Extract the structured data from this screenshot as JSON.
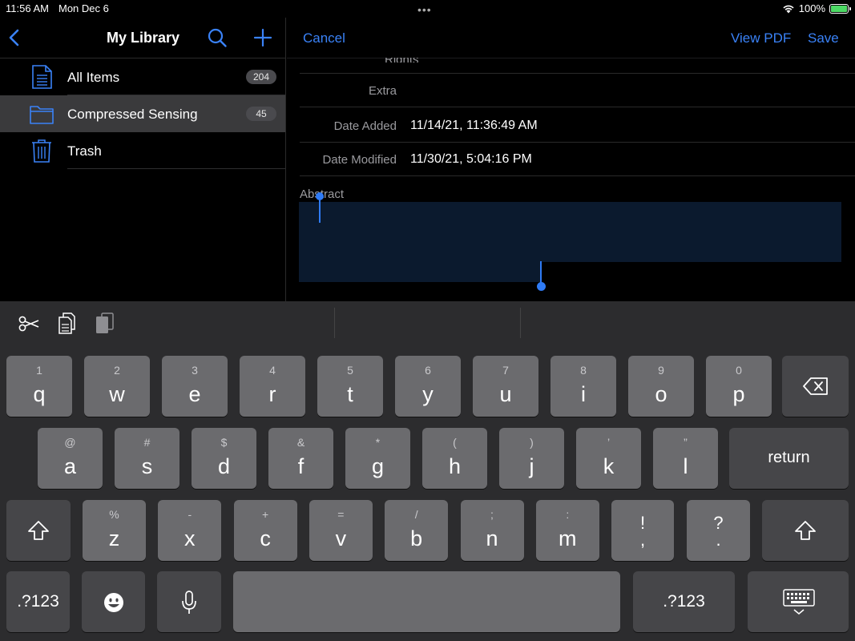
{
  "status": {
    "time": "11:56 AM",
    "date": "Mon Dec 6",
    "battery": "100%",
    "battery_level": 1.0
  },
  "sidebar": {
    "title": "My Library",
    "items": [
      {
        "label": "All Items",
        "count": "204",
        "icon": "document-icon"
      },
      {
        "label": "Compressed Sensing",
        "count": "45",
        "icon": "folder-icon",
        "selected": true
      },
      {
        "label": "Trash",
        "icon": "trash-icon"
      }
    ]
  },
  "detail": {
    "cancel": "Cancel",
    "view_pdf": "View PDF",
    "save": "Save",
    "rights_label": "Rights",
    "fields": [
      {
        "label": "Extra",
        "value": ""
      },
      {
        "label": "Date Added",
        "value": "11/14/21, 11:36:49 AM"
      },
      {
        "label": "Date Modified",
        "value": "11/30/21, 5:04:16 PM"
      }
    ],
    "abstract_label": "Abstract"
  },
  "keyboard": {
    "row1": [
      {
        "sub": "1",
        "main": "q"
      },
      {
        "sub": "2",
        "main": "w"
      },
      {
        "sub": "3",
        "main": "e"
      },
      {
        "sub": "4",
        "main": "r"
      },
      {
        "sub": "5",
        "main": "t"
      },
      {
        "sub": "6",
        "main": "y"
      },
      {
        "sub": "7",
        "main": "u"
      },
      {
        "sub": "8",
        "main": "i"
      },
      {
        "sub": "9",
        "main": "o"
      },
      {
        "sub": "0",
        "main": "p"
      }
    ],
    "row2": [
      {
        "sub": "@",
        "main": "a"
      },
      {
        "sub": "#",
        "main": "s"
      },
      {
        "sub": "$",
        "main": "d"
      },
      {
        "sub": "&",
        "main": "f"
      },
      {
        "sub": "*",
        "main": "g"
      },
      {
        "sub": "(",
        "main": "h"
      },
      {
        "sub": ")",
        "main": "j"
      },
      {
        "sub": "’",
        "main": "k"
      },
      {
        "sub": "”",
        "main": "l"
      }
    ],
    "row3": [
      {
        "sub": "%",
        "main": "z"
      },
      {
        "sub": "-",
        "main": "x"
      },
      {
        "sub": "+",
        "main": "c"
      },
      {
        "sub": "=",
        "main": "v"
      },
      {
        "sub": "/",
        "main": "b"
      },
      {
        "sub": ";",
        "main": "n"
      },
      {
        "sub": ":",
        "main": "m"
      }
    ],
    "punct": [
      {
        "top": "!",
        "bottom": ","
      },
      {
        "top": "?",
        "bottom": "."
      }
    ],
    "return": "return",
    "numbers_left": ".?123",
    "numbers_right": ".?123"
  }
}
